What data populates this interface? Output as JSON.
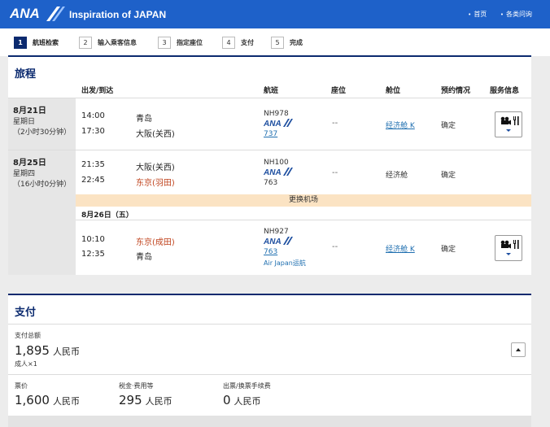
{
  "header": {
    "logo_text": "ANA",
    "tagline": "Inspiration of JAPAN",
    "links": [
      "首页",
      "各类问询"
    ]
  },
  "steps": [
    {
      "num": "1",
      "label": "航班检索"
    },
    {
      "num": "2",
      "label": "输入乘客信息"
    },
    {
      "num": "3",
      "label": "指定座位"
    },
    {
      "num": "4",
      "label": "支付"
    },
    {
      "num": "5",
      "label": "完成"
    }
  ],
  "itinerary": {
    "title": "旅程",
    "headers": {
      "depart_arrive": "出发/到达",
      "flight": "航班",
      "seat": "座位",
      "cabin": "舱位",
      "booking": "预约情况",
      "service": "服务信息"
    },
    "days": [
      {
        "date": "8月21日",
        "weekday": "星期日",
        "duration": "（2小时30分钟）",
        "segments": [
          {
            "dep_time": "14:00",
            "dep_city": "青岛",
            "arr_time": "17:30",
            "arr_city": "大阪(关西)",
            "flight_no": "NH978",
            "aircraft": "737",
            "operator": "",
            "seat": "--",
            "cabin": "经济舱 K",
            "status": "确定"
          }
        ]
      },
      {
        "date": "8月25日",
        "weekday": "星期四",
        "duration": "（16小时0分钟）",
        "segments": [
          {
            "dep_time": "21:35",
            "dep_city": "大阪(关西)",
            "arr_time": "22:45",
            "arr_city": "东京(羽田)",
            "flight_no": "NH100",
            "aircraft": "763",
            "operator": "",
            "seat": "--",
            "cabin": "经济舱",
            "status": "确定"
          },
          {
            "dep_time": "10:10",
            "dep_city": "东京(成田)",
            "arr_time": "12:35",
            "arr_city": "青岛",
            "flight_no": "NH927",
            "aircraft": "763",
            "operator": "Air Japan运航",
            "seat": "--",
            "cabin": "经济舱 K",
            "status": "确定"
          }
        ],
        "transfer_label": "更换机场",
        "next_day_label": "8月26日（五）"
      }
    ]
  },
  "payment": {
    "title": "支付",
    "total_label": "支付总额",
    "total_amount": "1,895",
    "currency": "人民币",
    "passenger": "成人×1",
    "fare_label": "票价",
    "fare_amount": "1,600",
    "tax_label": "税金·费用等",
    "tax_amount": "295",
    "fee_label": "出票/换票手续费",
    "fee_amount": "0"
  },
  "colors": {
    "brand": "#1e61c9",
    "navy": "#0b2a6f",
    "transfer_bg": "#fbe3c3",
    "red_city": "#c0431d",
    "link": "#1f6fb0"
  }
}
